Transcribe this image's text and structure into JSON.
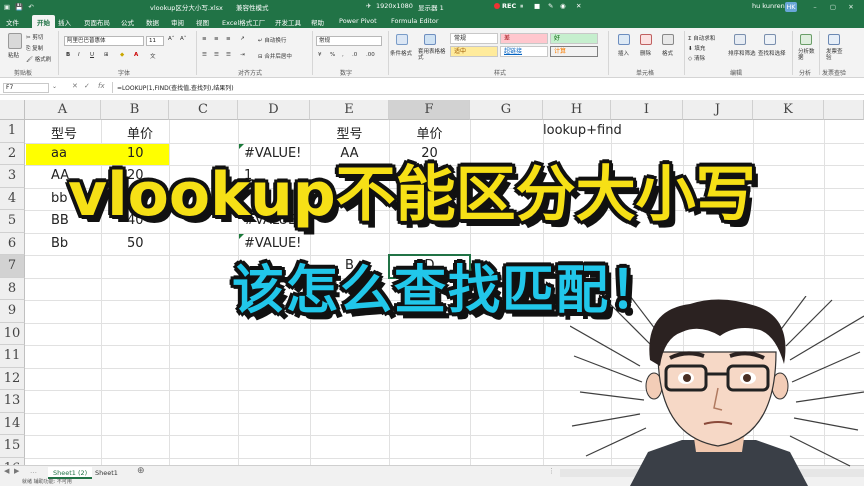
{
  "titlebar": {
    "filename": "vlookup区分大小写.xlsx",
    "mode": "兼容性模式",
    "resolution": "1920x1080",
    "display": "显示器 1",
    "rec": "REC",
    "user": "hu kunren",
    "user_initials": "HK"
  },
  "menu": {
    "tabs": [
      "文件",
      "开始",
      "插入",
      "页面布局",
      "公式",
      "数据",
      "审阅",
      "视图",
      "Excel格式工厂",
      "开发工具",
      "帮助",
      "Power Pivot",
      "Formula Editor"
    ],
    "active": "开始"
  },
  "ribbon": {
    "clipboard": {
      "label": "剪贴板",
      "cut": "剪切",
      "copy": "复制",
      "format_painter": "格式刷",
      "paste": "粘贴"
    },
    "font": {
      "label": "字体",
      "font_name": "阿里巴巴普惠体",
      "font_size": "11"
    },
    "alignment": {
      "label": "对齐方式",
      "wrap": "自动换行",
      "merge": "合并后居中"
    },
    "number": {
      "label": "数字",
      "format": "常规"
    },
    "styles": {
      "label": "样式",
      "conditional": "条件格式",
      "table": "套用表格格式",
      "normal": "常规",
      "bad": "差",
      "good": "好",
      "neutral": "适中",
      "hyperlink": "超链接",
      "calc": "计算"
    },
    "cells": {
      "label": "单元格",
      "insert": "插入",
      "delete": "删除",
      "format": "格式"
    },
    "editing": {
      "label": "编辑",
      "autosum": "自动求和",
      "fill": "填充",
      "clear": "清除",
      "sort": "排序和筛选",
      "find": "查找和选择"
    },
    "analysis": {
      "label": "分析",
      "analyze": "分析数据"
    },
    "invoice": {
      "label": "发票查验",
      "check": "发票查验"
    }
  },
  "formula_bar": {
    "name_box": "F7",
    "formula": "=LOOKUP(1,FIND(查找值,查找列),结果列)"
  },
  "grid": {
    "columns": [
      "A",
      "B",
      "C",
      "D",
      "E",
      "F",
      "G",
      "H",
      "I",
      "J",
      "K"
    ],
    "rows": [
      "1",
      "2",
      "3",
      "4",
      "5",
      "6",
      "7",
      "8",
      "9",
      "10",
      "11",
      "12",
      "13",
      "14",
      "15",
      "16"
    ],
    "cells": {
      "A1": "型号",
      "B1": "单价",
      "A2": "aa",
      "B2": "10",
      "A3": "AA",
      "B3": "20",
      "A4": "bb",
      "B4": "30",
      "A5": "BB",
      "B5": "40",
      "A6": "Bb",
      "B6": "50",
      "E1": "型号",
      "F1": "单价",
      "H1": "lookup+find",
      "D2": "#VALUE!",
      "E2": "AA",
      "F2": "20",
      "D3": "1",
      "D5": "#VALUE!",
      "D6": "#VALUE!",
      "E7": "B",
      "F7": "D"
    },
    "highlight_color": "#ffff00"
  },
  "overlay": {
    "line1": "vlookup不能区分大小写",
    "line2": "该怎么查找匹配！",
    "line1_color": "#f6e016",
    "line2_color": "#21c7ea"
  },
  "sheets": {
    "tabs": [
      "Sheet1 (2)",
      "Sheet1"
    ],
    "active": "Sheet1 (2)",
    "add": "⊕"
  },
  "status": {
    "text": "就绪  辅助功能: 不可用"
  },
  "colors": {
    "excel_green": "#217346",
    "ribbon_bg": "#f3f3f3"
  }
}
